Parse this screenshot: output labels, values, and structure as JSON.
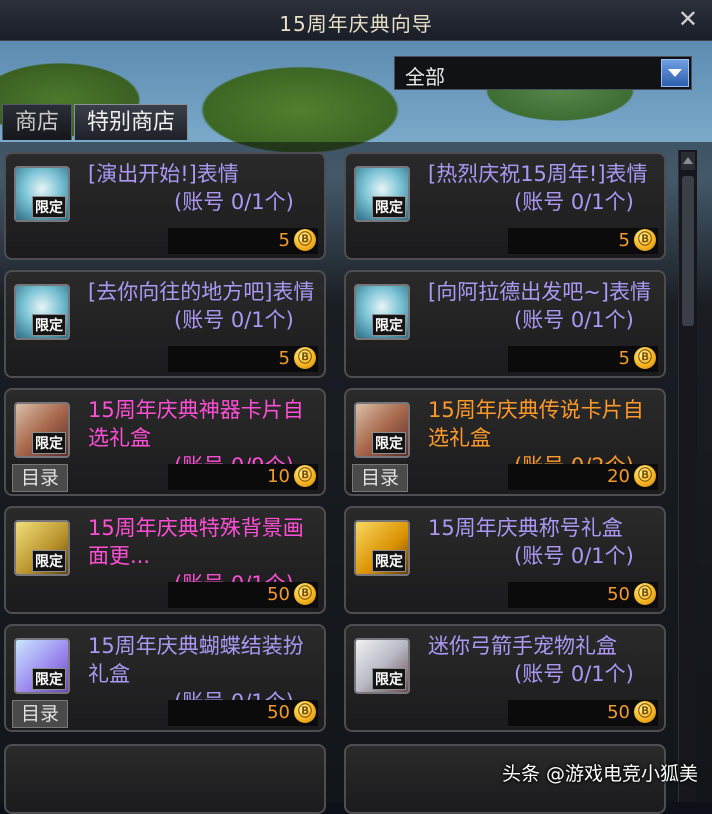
{
  "window": {
    "title": "15周年庆典向导",
    "close_glyph": "✕"
  },
  "filter": {
    "selected": "全部"
  },
  "tabs": [
    {
      "label": "商店"
    },
    {
      "label": "特别商店"
    }
  ],
  "items": [
    {
      "name": "[演出开始!]表情",
      "limit": "(账号 0/1个)",
      "price": "5",
      "badge": "限定",
      "color": "purple",
      "icon": "emote-box-icon"
    },
    {
      "name": "[热烈庆祝15周年!]表情",
      "limit": "(账号 0/1个)",
      "price": "5",
      "badge": "限定",
      "color": "purple",
      "icon": "emote-box-icon"
    },
    {
      "name": "[去你向往的地方吧]表情",
      "limit": "(账号 0/1个)",
      "price": "5",
      "badge": "限定",
      "color": "purple",
      "icon": "emote-box-icon"
    },
    {
      "name": "[向阿拉德出发吧~]表情",
      "limit": "(账号 0/1个)",
      "price": "5",
      "badge": "限定",
      "color": "purple",
      "icon": "emote-box-icon"
    },
    {
      "name": "15周年庆典神器卡片自选礼盒",
      "limit": "(账号 0/9个)",
      "price": "10",
      "badge": "限定",
      "color": "pink",
      "icon": "card-box-icon",
      "catalog": "目录"
    },
    {
      "name": "15周年庆典传说卡片自选礼盒",
      "limit": "(账号 0/2个)",
      "price": "20",
      "badge": "限定",
      "color": "orange",
      "icon": "card-box-icon",
      "catalog": "目录"
    },
    {
      "name": "15周年庆典特殊背景画面更...",
      "limit": "(账号 0/1个)",
      "price": "50",
      "badge": "限定",
      "color": "pink",
      "icon": "background-frame-icon"
    },
    {
      "name": "15周年庆典称号礼盒",
      "limit": "(账号 0/1个)",
      "price": "50",
      "badge": "限定",
      "color": "purple",
      "icon": "title-15-icon"
    },
    {
      "name": "15周年庆典蝴蝶结装扮礼盒",
      "limit": "(账号 0/1个)",
      "price": "50",
      "badge": "限定",
      "color": "purple",
      "icon": "bow-gift-icon",
      "catalog": "目录"
    },
    {
      "name": "迷你弓箭手宠物礼盒",
      "limit": "(账号 0/1个)",
      "price": "50",
      "badge": "限定",
      "color": "purple",
      "icon": "pet-archer-icon"
    }
  ],
  "coin_glyph": "Ⓑ",
  "watermark": "头条 @游戏电竞小狐美"
}
